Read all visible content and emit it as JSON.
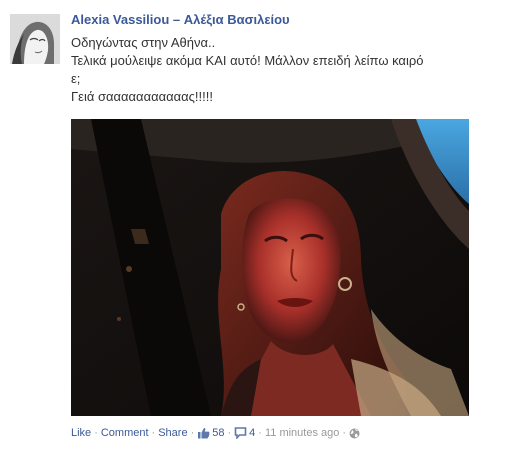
{
  "post": {
    "author": "Alexia Vassiliou – Αλέξια Βασιλείου",
    "text_lines": [
      "Οδηγώντας στην Αθήνα..",
      "Τελικά μούλειψε ακόμα ΚΑΙ αυτό! Μάλλον επειδή λείπω καιρό",
      "ε;",
      "Γειά σααααααααααας!!!!!"
    ]
  },
  "actions": {
    "like": "Like",
    "comment": "Comment",
    "share": "Share",
    "separator": "·",
    "likes_count": "58",
    "comments_count": "4",
    "timestamp": "11 minutes ago"
  },
  "icons": {
    "like": "thumbs-up-icon",
    "comments": "speech-bubble-icon",
    "audience": "globe-icon"
  },
  "colors": {
    "link": "#3b5998",
    "text": "#333333",
    "meta": "#999999"
  }
}
